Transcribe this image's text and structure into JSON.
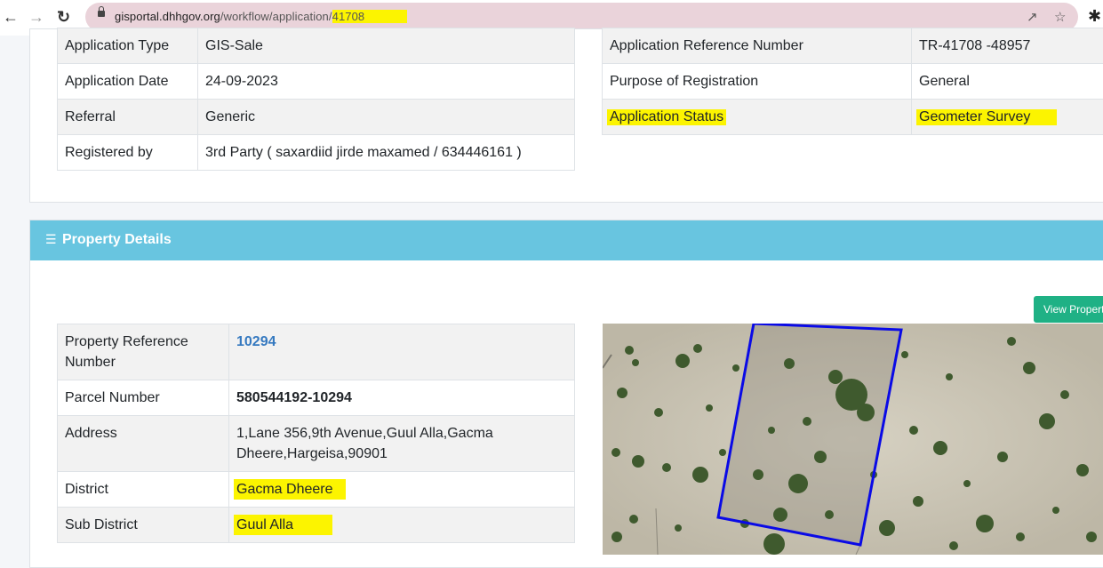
{
  "browser": {
    "url_domain": "gisportal.dhhgov.org",
    "url_path": "/workflow/application/",
    "url_highlighted": "41708"
  },
  "application": {
    "left_rows": [
      {
        "label": "Application Type",
        "value": "GIS-Sale"
      },
      {
        "label": "Application Date",
        "value": "24-09-2023"
      },
      {
        "label": "Referral",
        "value": "Generic"
      },
      {
        "label": "Registered by",
        "value": "3rd Party ( saxardiid jirde maxamed / 634446161 )"
      }
    ],
    "right_rows": [
      {
        "label": "Application Reference Number",
        "value": "TR-41708 -48957"
      },
      {
        "label": "Purpose of Registration",
        "value": "General"
      },
      {
        "label": "Application Status",
        "value": "Geometer Survey"
      }
    ]
  },
  "property": {
    "section_title": "Property Details",
    "section_icon": "list-icon",
    "view_button_label": "View Propert",
    "rows": [
      {
        "label": "Property Reference Number",
        "value": "10294"
      },
      {
        "label": "Parcel Number",
        "value": "580544192-10294"
      },
      {
        "label": "Address",
        "value": "1,Lane 356,9th Avenue,Guul Alla,Gacma Dheere,Hargeisa,90901"
      },
      {
        "label": "District",
        "value": "Gacma Dheere"
      },
      {
        "label": "Sub District",
        "value": "Guul Alla"
      }
    ]
  },
  "colors": {
    "header": "#68c5e0",
    "button": "#1fb185",
    "link": "#3579c0",
    "highlight": "#fcf400",
    "parcel_outline": "#0a0ae6"
  }
}
